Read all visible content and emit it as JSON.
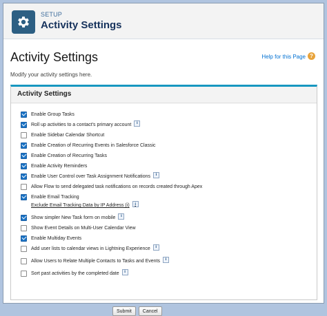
{
  "header": {
    "setup_label": "SETUP",
    "title": "Activity Settings"
  },
  "page": {
    "title": "Activity Settings",
    "help_link": "Help for this Page",
    "description": "Modify your activity settings here."
  },
  "panel": {
    "title": "Activity Settings",
    "settings": [
      {
        "label": "Enable Group Tasks",
        "checked": true,
        "info": false
      },
      {
        "label": "Roll up activities to a contact's primary account",
        "checked": true,
        "info": true
      },
      {
        "label": "Enable Sidebar Calendar Shortcut",
        "checked": false,
        "info": false
      },
      {
        "label": "Enable Creation of Recurring Events in Salesforce Classic",
        "checked": true,
        "info": false
      },
      {
        "label": "Enable Creation of Recurring Tasks",
        "checked": true,
        "info": false
      },
      {
        "label": "Enable Activity Reminders",
        "checked": true,
        "info": false
      },
      {
        "label": "Enable User Control over Task Assignment Notifications",
        "checked": true,
        "info": true
      },
      {
        "label": "Allow Flow to send delegated task notifications on records created through Apex",
        "checked": false,
        "info": false
      },
      {
        "label": "Enable Email Tracking",
        "checked": true,
        "info": false
      },
      {
        "label": "Show simpler New Task form on mobile",
        "checked": true,
        "info": true
      },
      {
        "label": "Show Event Details on Multi-User Calendar View",
        "checked": false,
        "info": false
      },
      {
        "label": "Enable Multiday Events",
        "checked": true,
        "info": false
      },
      {
        "label": "Add user lists to calendar views in Lightning Experience",
        "checked": false,
        "info": true
      },
      {
        "label": "Allow Users to Relate Multiple Contacts to Tasks and Events",
        "checked": false,
        "info": true
      },
      {
        "label": "Sort past activities by the completed date",
        "checked": false,
        "info": true
      }
    ],
    "email_tracking_link": "Exclude Email Tracking Data by IP Address (i)",
    "submit_label": "Submit",
    "cancel_label": "Cancel"
  },
  "colors": {
    "background": "#b0c4df",
    "header_icon": "#2d5f83",
    "title": "#16325c",
    "link": "#0070d2",
    "panel_accent": "#1797c0",
    "checkbox_checked": "#1a73c5"
  },
  "icons": {
    "header": "gear-icon",
    "help": "help-icon",
    "info": "info-icon"
  }
}
